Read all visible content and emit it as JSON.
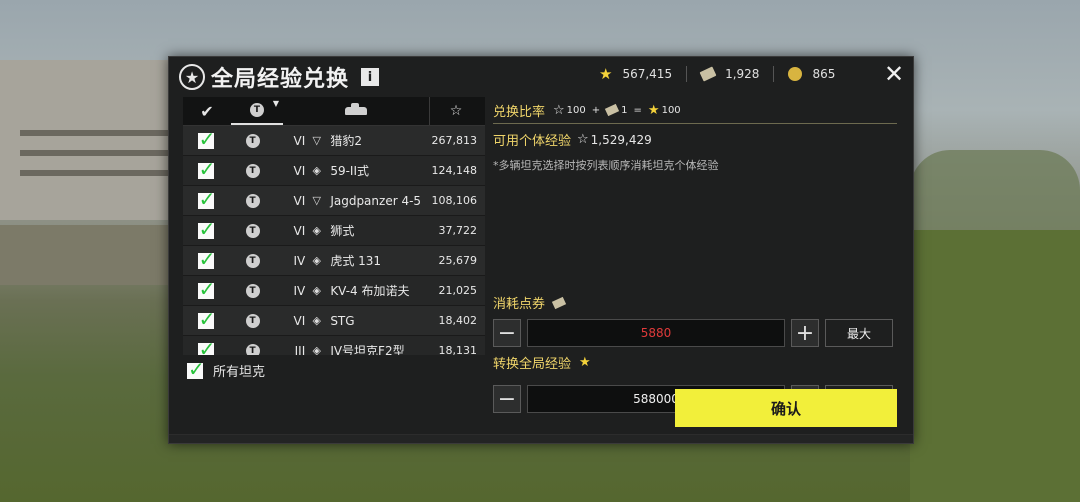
{
  "dialog": {
    "title": "全局经验兑换",
    "info_label": "i",
    "close_label": "✕"
  },
  "currencies": [
    {
      "icon": "gold-star-icon",
      "value": "567,415"
    },
    {
      "icon": "ticket-icon",
      "value": "1,928"
    },
    {
      "icon": "gold-coin-icon",
      "value": "865"
    }
  ],
  "list": {
    "rows": [
      {
        "checked": true,
        "tier": "VI",
        "type": "tank-destroyer-icon",
        "name": "猎豹2",
        "exp": "267,813"
      },
      {
        "checked": true,
        "tier": "VI",
        "type": "medium-tank-icon",
        "name": "59-II式",
        "exp": "124,148"
      },
      {
        "checked": true,
        "tier": "VI",
        "type": "tank-destroyer-icon",
        "name": "Jagdpanzer 4-5",
        "exp": "108,106"
      },
      {
        "checked": true,
        "tier": "VI",
        "type": "medium-tank-icon",
        "name": "狮式",
        "exp": "37,722"
      },
      {
        "checked": true,
        "tier": "IV",
        "type": "medium-tank-icon",
        "name": "虎式 131",
        "exp": "25,679"
      },
      {
        "checked": true,
        "tier": "IV",
        "type": "medium-tank-icon",
        "name": "KV-4 布加诺夫",
        "exp": "21,025"
      },
      {
        "checked": true,
        "tier": "VI",
        "type": "medium-tank-icon",
        "name": "STG",
        "exp": "18,402"
      },
      {
        "checked": true,
        "tier": "III",
        "type": "medium-tank-icon",
        "name": "IV号坦克F2型",
        "exp": "18,131"
      }
    ],
    "all_tanks_label": "所有坦克"
  },
  "exchange": {
    "ratio_label": "兑换比率",
    "ratio_star_amount": "100",
    "ratio_plus": "+",
    "ratio_ticket_amount": "1",
    "ratio_equals": "=",
    "ratio_result": "100",
    "available_label": "可用个体经验",
    "available_value": "1,529,429",
    "note": "*多辆坦克选择时按列表顺序消耗坦克个体经验",
    "cost_label": "消耗点券",
    "cost_value": "5880",
    "convert_label": "转换全局经验",
    "convert_value": "588000",
    "minus_label": "−",
    "plus_label": "+",
    "max_label": "最大",
    "confirm_label": "确认"
  },
  "colors": {
    "accent_gold": "#f0d56a",
    "confirm_yellow": "#f2ef3a",
    "cost_red": "#e03a3a",
    "check_green": "#27c23a"
  }
}
